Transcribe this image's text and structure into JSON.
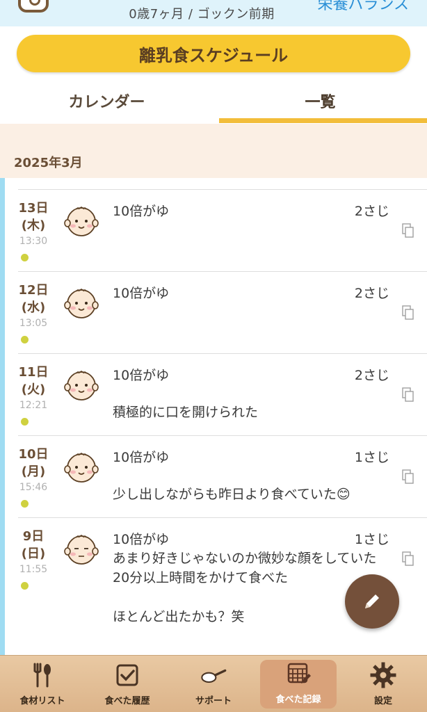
{
  "header": {
    "age": "0歳7ヶ月 / ゴックン前期",
    "nutrition_link": "栄養バランス"
  },
  "schedule_button": "離乳食スケジュール",
  "tabs": [
    {
      "label": "カレンダー",
      "selected": false
    },
    {
      "label": "一覧",
      "selected": true
    }
  ],
  "month": "2025年3月",
  "entries": [
    {
      "day": "13日",
      "weekday": "(木)",
      "time": "13:30",
      "food": "10倍がゆ",
      "amount": "2さじ",
      "memo": ""
    },
    {
      "day": "12日",
      "weekday": "(水)",
      "time": "13:05",
      "food": "10倍がゆ",
      "amount": "2さじ",
      "memo": ""
    },
    {
      "day": "11日",
      "weekday": "(火)",
      "time": "12:21",
      "food": "10倍がゆ",
      "amount": "2さじ",
      "memo": "積極的に口を開けられた"
    },
    {
      "day": "10日",
      "weekday": "(月)",
      "time": "15:46",
      "food": "10倍がゆ",
      "amount": "1さじ",
      "memo": "少し出しながらも昨日より食べていた😊"
    },
    {
      "day": "9日",
      "weekday": "(日)",
      "time": "11:55",
      "food": "10倍がゆ",
      "amount": "1さじ",
      "memo": "あまり好きじゃないのか微妙な顔をしていた\n20分以上時間をかけて食べた\n\nほとんど出たかも？笑"
    }
  ],
  "colors": {
    "accent_yellow": "#f7c830",
    "brand_brown": "#74503a",
    "left_bar_blue": "#9fdcf2",
    "dot_olive": "#cfd140"
  },
  "bottom_nav": [
    {
      "label": "食材リスト",
      "icon": "cutlery-icon",
      "active": false
    },
    {
      "label": "食べた履歴",
      "icon": "checkbox-icon",
      "active": false
    },
    {
      "label": "サポート",
      "icon": "spoon-icon",
      "active": false
    },
    {
      "label": "食べた記録",
      "icon": "calendar-edit-icon",
      "active": true
    },
    {
      "label": "設定",
      "icon": "gear-icon",
      "active": false
    }
  ],
  "fab": {
    "icon": "pencil-icon"
  }
}
